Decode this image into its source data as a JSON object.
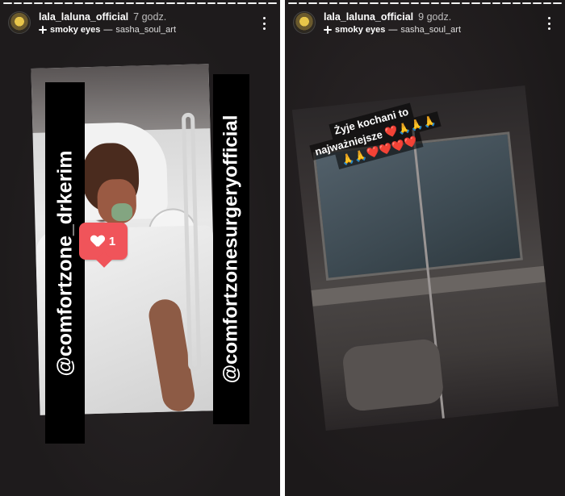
{
  "stories": [
    {
      "username": "lala_laluna_official",
      "time": "7 godz.",
      "music": {
        "song": "smoky eyes",
        "separator": "—",
        "artist": "sasha_soul_art"
      },
      "progress_segments": 27,
      "progress_done": 27,
      "mentions": [
        "@comfortzone_drkerim",
        "@comfortzonesurgeryofficial"
      ],
      "like_sticker": {
        "count": "1"
      }
    },
    {
      "username": "lala_laluna_official",
      "time": "9 godz.",
      "music": {
        "song": "smoky eyes",
        "separator": "—",
        "artist": "sasha_soul_art"
      },
      "progress_segments": 27,
      "progress_done": 27,
      "caption": {
        "line1": "Żyje kochani to",
        "line2": "najważniejsze ❤️🙏🙏🙏",
        "line3": "🙏🙏❤️❤️❤️❤️"
      }
    }
  ],
  "colors": {
    "background": "#201d1e",
    "like_sticker": "#f0545a",
    "tag_background": "#000000"
  },
  "icons": [
    "avatar",
    "sparkle-icon",
    "more-options-icon",
    "heart-icon"
  ]
}
